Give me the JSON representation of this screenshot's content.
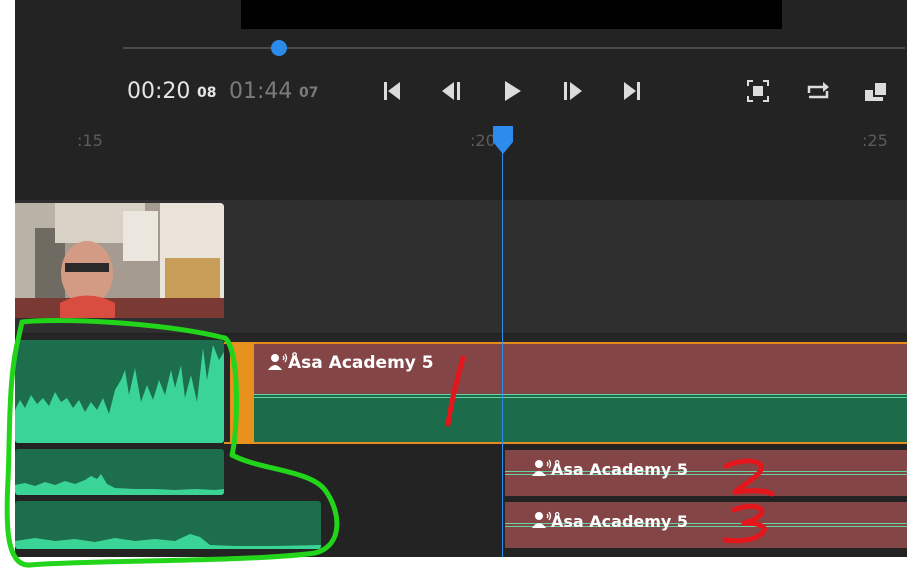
{
  "player": {
    "current_time": "00:20",
    "current_frames": "08",
    "duration_time": "01:44",
    "duration_frames": "07",
    "playhead_progress": 0.2
  },
  "transport": [
    "skip-to-start-icon",
    "step-back-icon",
    "play-icon",
    "step-forward-icon",
    "skip-to-end-icon"
  ],
  "right_controls": [
    "fullscreen-icon",
    "loop-icon",
    "export-frame-icon"
  ],
  "ruler": {
    "ticks": [
      ":15",
      ":20",
      ":25"
    ]
  },
  "clips": {
    "a1_label": "Åsa Academy 5",
    "a2_label": "Åsa Academy 5",
    "a3_label": "Åsa Academy 5"
  },
  "annotations": {
    "marks": [
      "1",
      "2",
      "3"
    ],
    "highlight_color": "#22d51a",
    "mark_color": "#e5161b"
  },
  "colors": {
    "accent": "#2d8ceb",
    "selection": "#e8921d",
    "audio_clip_top": "#844546",
    "audio_wave": "#1c6b4a"
  }
}
